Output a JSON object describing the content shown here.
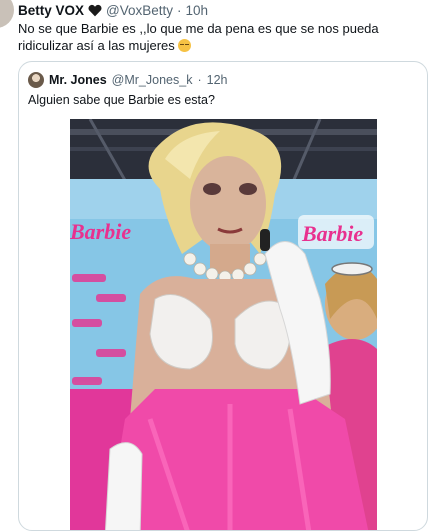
{
  "tweet": {
    "author_name": "Betty VOX",
    "heart_emoji": "black-heart-icon",
    "handle": "@VoxBetty",
    "separator": "·",
    "time": "10h",
    "text": "No se que Barbie es ,,lo que me da pena es que se nos  pueda ridiculizar así a las mujeres",
    "emoji": "pensive-face-icon"
  },
  "quote": {
    "author_name": "Mr. Jones",
    "handle": "@Mr_Jones_k",
    "separator": "·",
    "time": "12h",
    "text": "Alguien sabe que Barbie es esta?",
    "media": {
      "signs": [
        "Barbie",
        "Barbie"
      ],
      "colors": {
        "backdrop": "#86c6e6",
        "carpet": "#e1379a",
        "dress": "#f04aa9",
        "hair": "#e8d58d"
      }
    }
  }
}
